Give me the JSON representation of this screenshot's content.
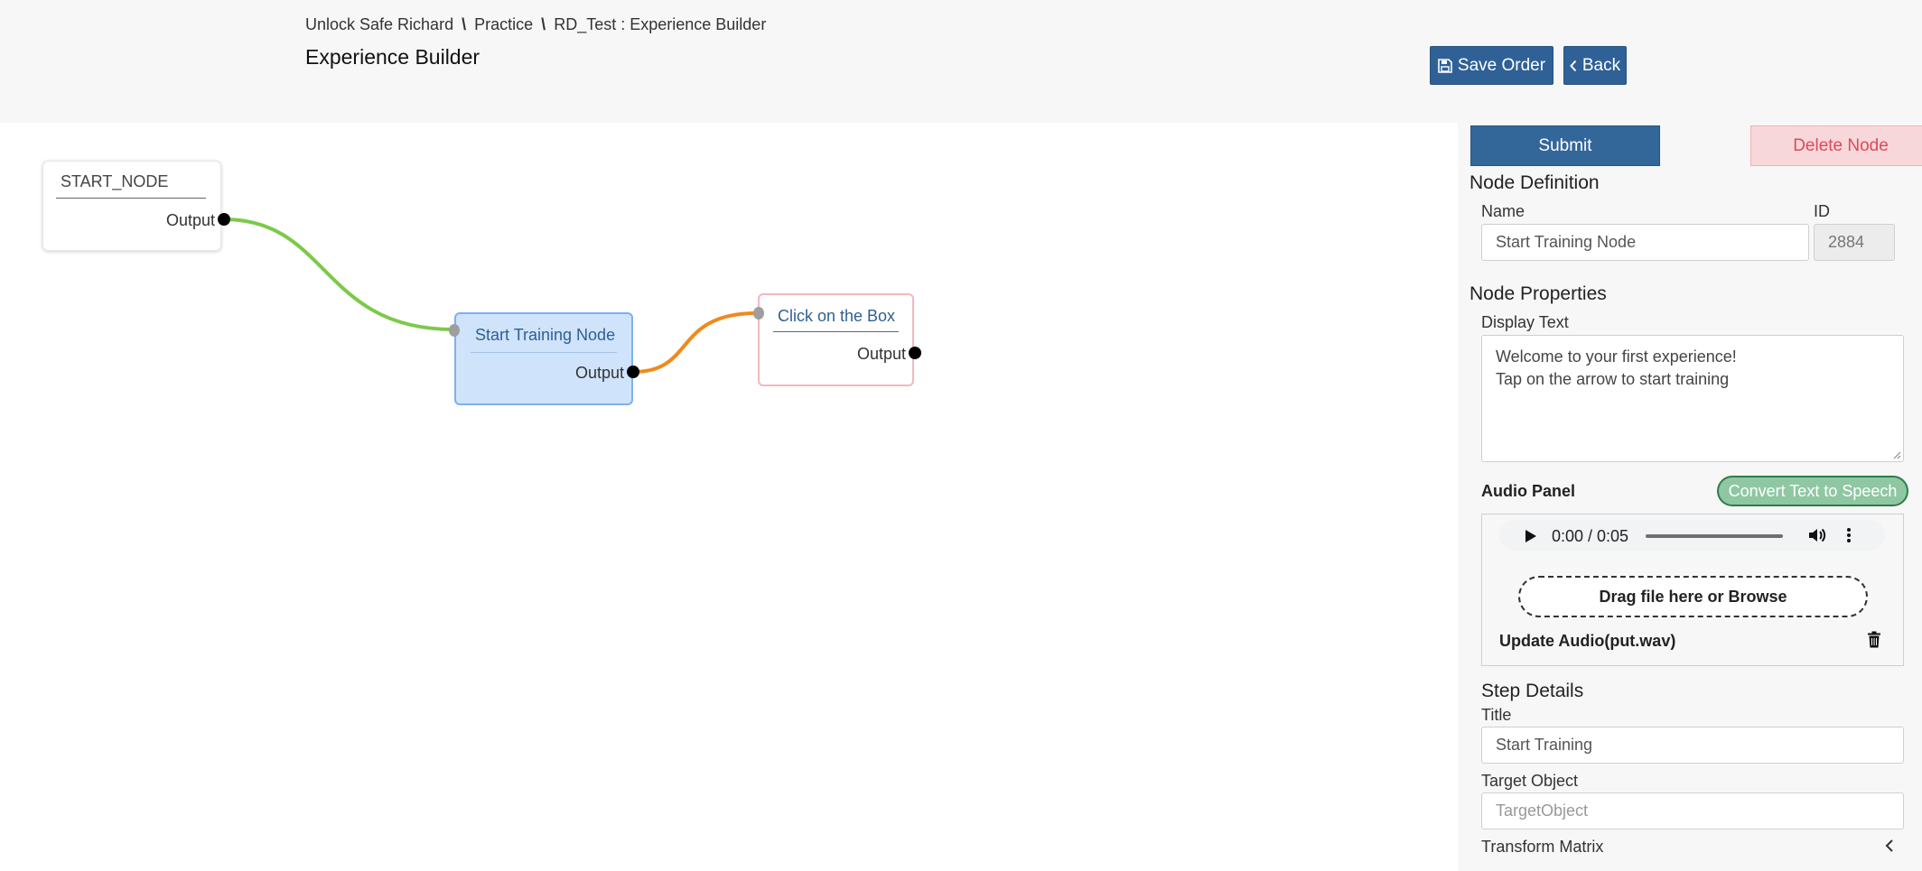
{
  "header": {
    "breadcrumb": {
      "part1": "Unlock Safe Richard",
      "sep1": "\\",
      "part2": "Practice",
      "sep2": "\\",
      "part3": "RD_Test : Experience Builder"
    },
    "title": "Experience Builder",
    "save_label": "Save Order",
    "back_label": "Back"
  },
  "canvas": {
    "nodes": [
      {
        "title": "START_NODE",
        "output_label": "Output"
      },
      {
        "title": "Start Training Node",
        "output_label": "Output"
      },
      {
        "title": "Click on the Box",
        "output_label": "Output"
      }
    ],
    "connection_colors": {
      "start_to_training": "#7cc94a",
      "training_to_click": "#f0891e"
    }
  },
  "panel": {
    "submit_label": "Submit",
    "delete_label": "Delete Node",
    "node_definition": {
      "heading": "Node Definition",
      "name_label": "Name",
      "name_value": "Start Training Node",
      "id_label": "ID",
      "id_value": "2884"
    },
    "node_properties": {
      "heading": "Node Properties",
      "display_text_label": "Display Text",
      "display_text_line1": "Welcome to your first experience!",
      "display_text_line2": "Tap on the arrow to start training"
    },
    "audio": {
      "heading": "Audio Panel",
      "tts_label": "Convert Text to Speech",
      "time": "0:00 / 0:05",
      "drop_label": "Drag file here or Browse",
      "update_label": "Update Audio(put.wav)"
    },
    "step_details": {
      "heading": "Step Details",
      "title_label": "Title",
      "title_value": "Start Training",
      "target_label": "Target Object",
      "target_placeholder": "TargetObject",
      "transform_label": "Transform Matrix"
    }
  },
  "colors": {
    "primary": "#2f6196",
    "danger_bg": "#f8d7da",
    "danger_text": "#dc4a5a",
    "success_bg": "#8fc7a3",
    "selected_node_bg": "#cfe3fb"
  }
}
